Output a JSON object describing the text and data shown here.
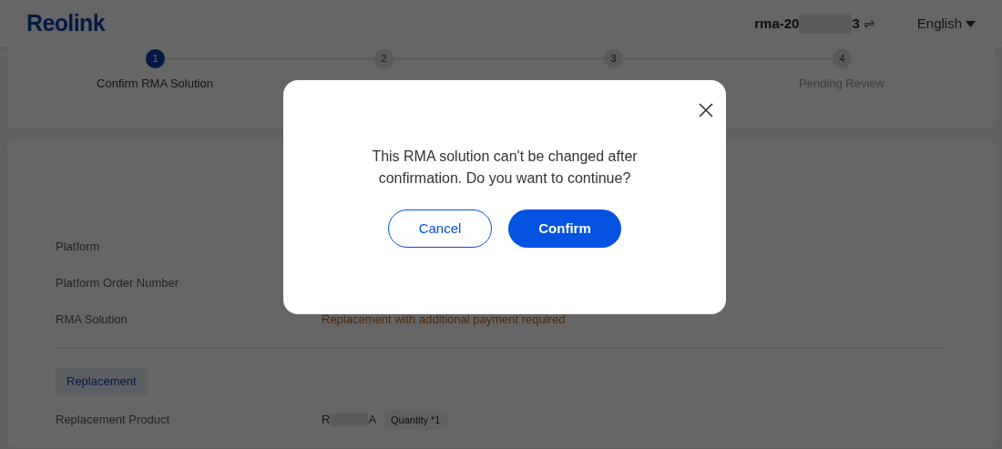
{
  "header": {
    "logo": "Reolink",
    "account_prefix": "rma-20",
    "account_suffix": "3",
    "switch_icon": "⇌",
    "language": "English"
  },
  "steps": [
    {
      "number": "1",
      "label": "Confirm RMA Solution",
      "selected": true
    },
    {
      "number": "2",
      "selected": false
    },
    {
      "number": "3",
      "selected": false
    },
    {
      "number": "4",
      "label": "Pending Review",
      "selected": false
    }
  ],
  "details": [
    {
      "label": "Platform"
    },
    {
      "label": "Platform Order Number"
    },
    {
      "label": "RMA Solution",
      "value": "Replacement with additional payment required"
    }
  ],
  "section_tag": "Replacement",
  "product": {
    "label": "Replacement Product",
    "value_prefix": "R",
    "value_suffix": "A",
    "quantity": "Quantity *1"
  },
  "dialog": {
    "message": "This RMA solution can't be changed after confirmation. Do you want to continue?",
    "buttons": [
      {
        "label": "Cancel",
        "kind": "secondary"
      },
      {
        "label": "Confirm",
        "kind": "primary"
      }
    ]
  }
}
